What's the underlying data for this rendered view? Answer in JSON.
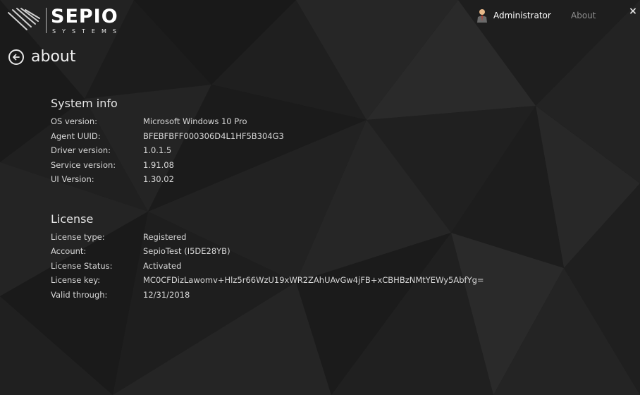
{
  "app": {
    "logo_text": "SEPIO",
    "logo_subtext": "SYSTEMS"
  },
  "header": {
    "user_label": "Administrator",
    "about_link": "About",
    "close_glyph": "×"
  },
  "page": {
    "title": "about"
  },
  "system_info": {
    "title": "System info",
    "rows": [
      {
        "label": "OS version:",
        "value": "Microsoft Windows 10 Pro"
      },
      {
        "label": "Agent UUID:",
        "value": "BFEBFBFF000306D4L1HF5B304G3"
      },
      {
        "label": "Driver version:",
        "value": "1.0.1.5"
      },
      {
        "label": "Service version:",
        "value": "1.91.08"
      },
      {
        "label": "UI Version:",
        "value": "1.30.02"
      }
    ]
  },
  "license": {
    "title": "License",
    "rows": [
      {
        "label": "License type:",
        "value": "Registered"
      },
      {
        "label": "Account:",
        "value": "SepioTest (I5DE28YB)"
      },
      {
        "label": "License Status:",
        "value": "Activated"
      },
      {
        "label": "License key:",
        "value": "MC0CFDizLawomv+Hlz5r66WzU19xWR2ZAhUAvGw4jFB+xCBHBzNMtYEWy5AbfYg="
      },
      {
        "label": "Valid through:",
        "value": "12/31/2018"
      }
    ]
  },
  "icons": {
    "logo": "sepio-logo-icon",
    "user": "user-icon",
    "back": "back-arrow-icon",
    "close": "close-icon"
  },
  "colors": {
    "background": "#1c1c1c",
    "text_primary": "#ffffff",
    "text_secondary": "#d8d8d8",
    "text_muted": "#8e8e8e",
    "user_icon_skin": "#e8b98a",
    "user_icon_body": "#6a6a6a"
  }
}
